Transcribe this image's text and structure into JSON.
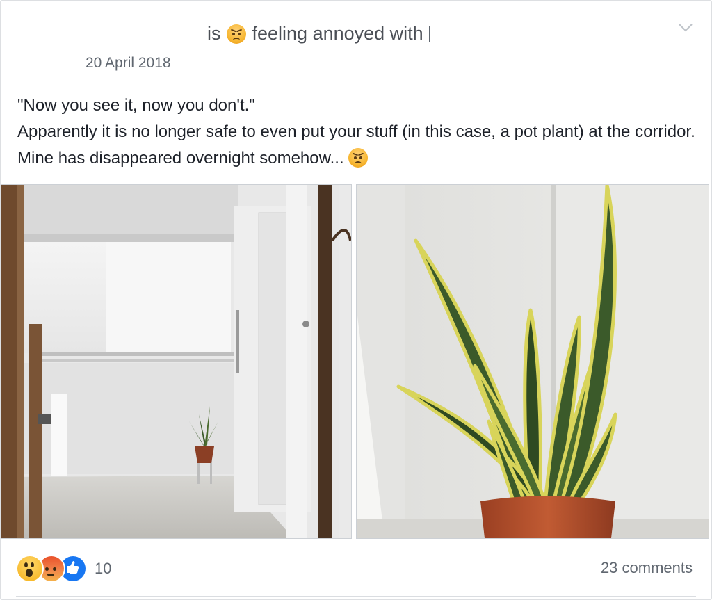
{
  "post": {
    "status_prefix": "is",
    "feeling_text": "feeling annoyed with",
    "feeling_icon": "angry-face-icon",
    "date": "20 April 2018",
    "text_line1": "\"Now you see it, now you don't.\"",
    "text_line2": "Apparently it is no longer safe to even put your stuff (in this case, a pot plant) at the corridor. Mine has disappeared overnight somehow...",
    "photos": [
      {
        "subject": "corridor-with-pot-plant"
      },
      {
        "subject": "snake-plant-closeup"
      }
    ]
  },
  "footer": {
    "reaction_icons": [
      "wow-reaction-icon",
      "angry-reaction-icon",
      "like-reaction-icon"
    ],
    "reaction_count": "10",
    "comments": "23 comments"
  },
  "colors": {
    "secondary_text": "#606770",
    "primary_text": "#1d2129",
    "like_blue": "#1877f2",
    "plant_green": "#3b5a2a",
    "plant_yellow": "#d8d45a",
    "pot": "#b8532e"
  }
}
